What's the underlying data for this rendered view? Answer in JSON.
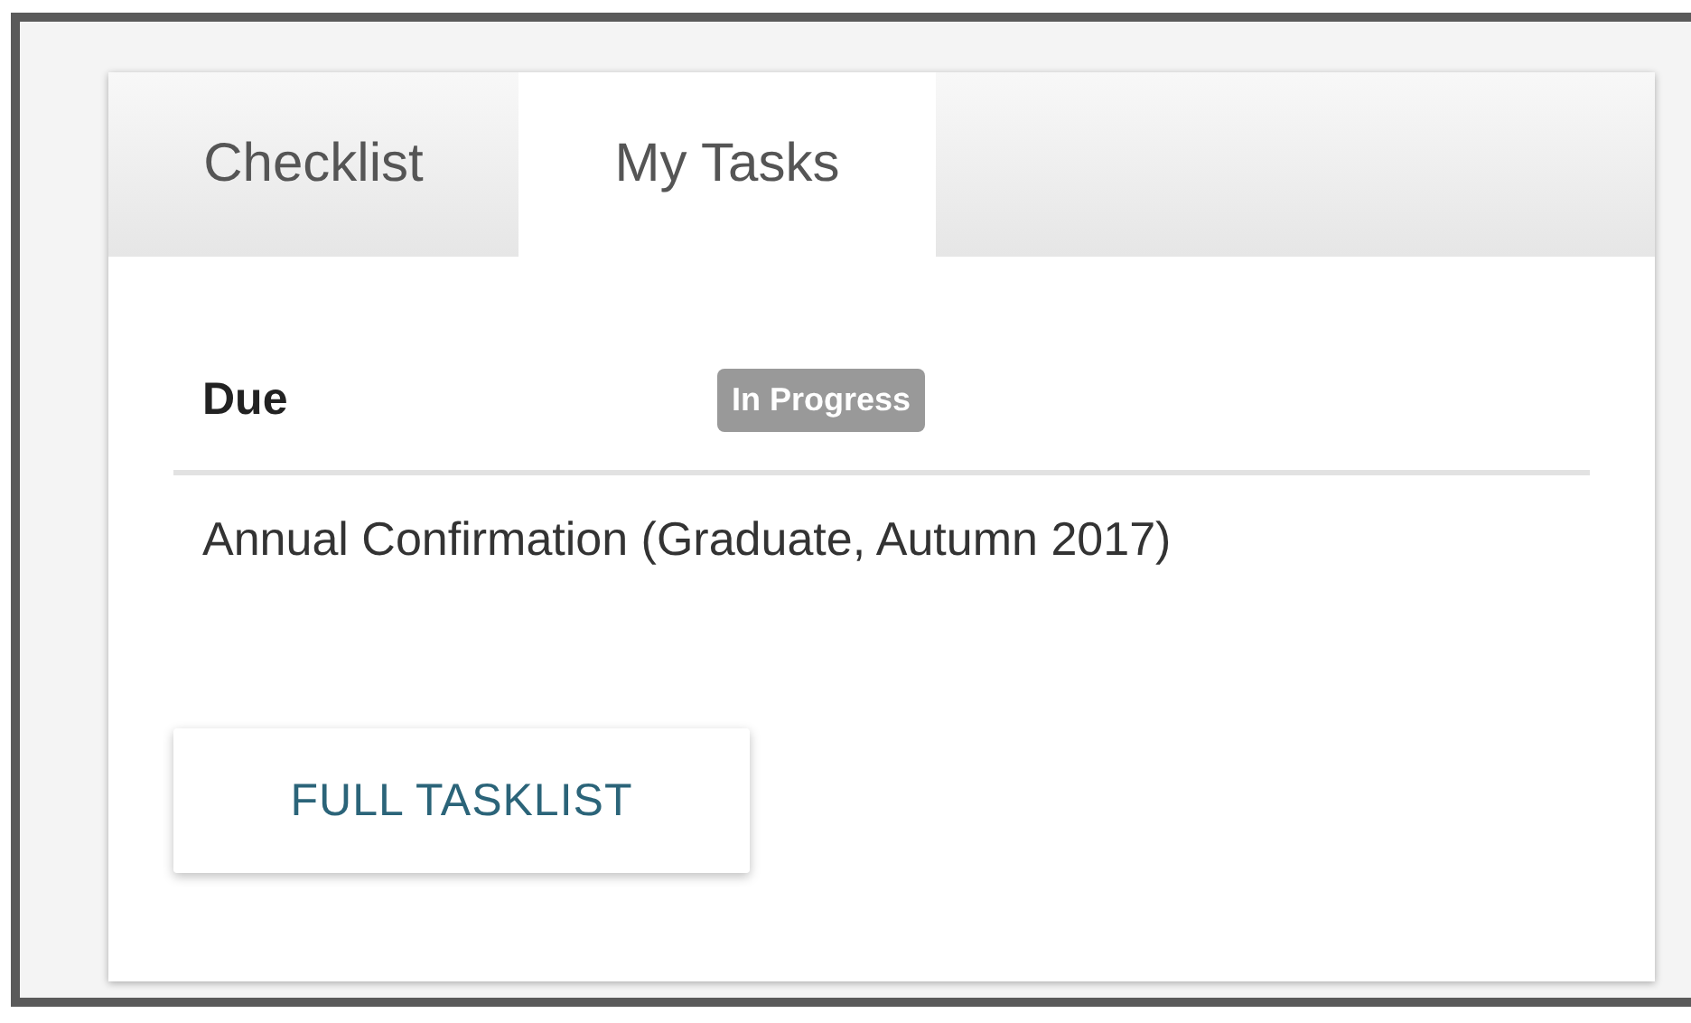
{
  "tabs": [
    {
      "label": "Checklist",
      "selected": false
    },
    {
      "label": "My Tasks",
      "selected": true
    }
  ],
  "table": {
    "header": "Due",
    "status_badge": "In Progress",
    "rows": [
      "Annual Confirmation (Graduate, Autumn 2017)"
    ]
  },
  "buttons": [
    "FULL TASKLIST"
  ]
}
